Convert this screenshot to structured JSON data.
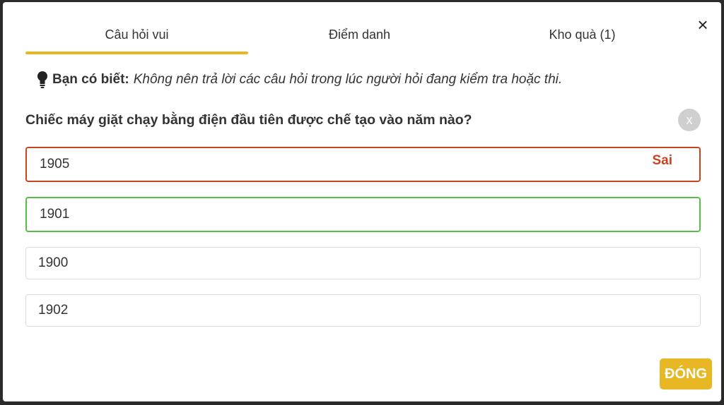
{
  "tabs": [
    {
      "label": "Câu hỏi vui",
      "active": true
    },
    {
      "label": "Điểm danh",
      "active": false
    },
    {
      "label": "Kho quà  (1)",
      "active": false
    }
  ],
  "close_icon": "×",
  "tip": {
    "icon": "lightbulb-icon",
    "label": "Bạn có biết:",
    "text": "Không nên trả lời các câu hỏi trong lúc người hỏi đang kiểm tra hoặc thi."
  },
  "question": {
    "text": "Chiếc máy giặt chạy bằng điện đầu tiên được chế tạo vào năm nào?",
    "dismiss_icon": "x"
  },
  "options": [
    {
      "value": "1905",
      "state": "wrong",
      "badge": "Sai"
    },
    {
      "value": "1901",
      "state": "correct"
    },
    {
      "value": "1900",
      "state": "neutral"
    },
    {
      "value": "1902",
      "state": "neutral"
    }
  ],
  "footer": {
    "close_label": "ĐÓNG"
  },
  "colors": {
    "accent": "#e8b824",
    "wrong": "#c8441f",
    "correct": "#56c046",
    "neutral_border": "#dcdcdc"
  }
}
